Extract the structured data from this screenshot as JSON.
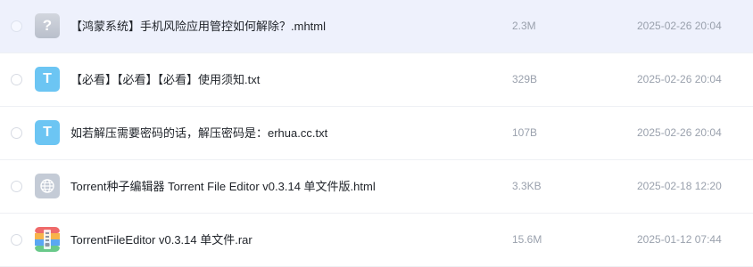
{
  "files": [
    {
      "name": "【鸿蒙系统】手机风险应用管控如何解除？.mhtml",
      "size": "2.3M",
      "date": "2025-02-26 20:04",
      "icon": "unknown-file-icon",
      "icon_glyph": "?",
      "selected": true
    },
    {
      "name": "【必看】【必看】【必看】使用须知.txt",
      "size": "329B",
      "date": "2025-02-26 20:04",
      "icon": "txt-file-icon",
      "icon_glyph": "T",
      "selected": false
    },
    {
      "name": "如若解压需要密码的话，解压密码是：erhua.cc.txt",
      "size": "107B",
      "date": "2025-02-26 20:04",
      "icon": "txt-file-icon",
      "icon_glyph": "T",
      "selected": false
    },
    {
      "name": "Torrent种子编辑器 Torrent File Editor v0.3.14 单文件版.html",
      "size": "3.3KB",
      "date": "2025-02-18 12:20",
      "icon": "html-file-icon",
      "selected": false
    },
    {
      "name": "TorrentFileEditor v0.3.14 单文件.rar",
      "size": "15.6M",
      "date": "2025-01-12 07:44",
      "icon": "rar-archive-icon",
      "selected": false
    }
  ],
  "colors": {
    "selected_row": "#eef1fc",
    "txt_icon": "#6cc5f3",
    "meta_text": "#9aa1ad"
  }
}
